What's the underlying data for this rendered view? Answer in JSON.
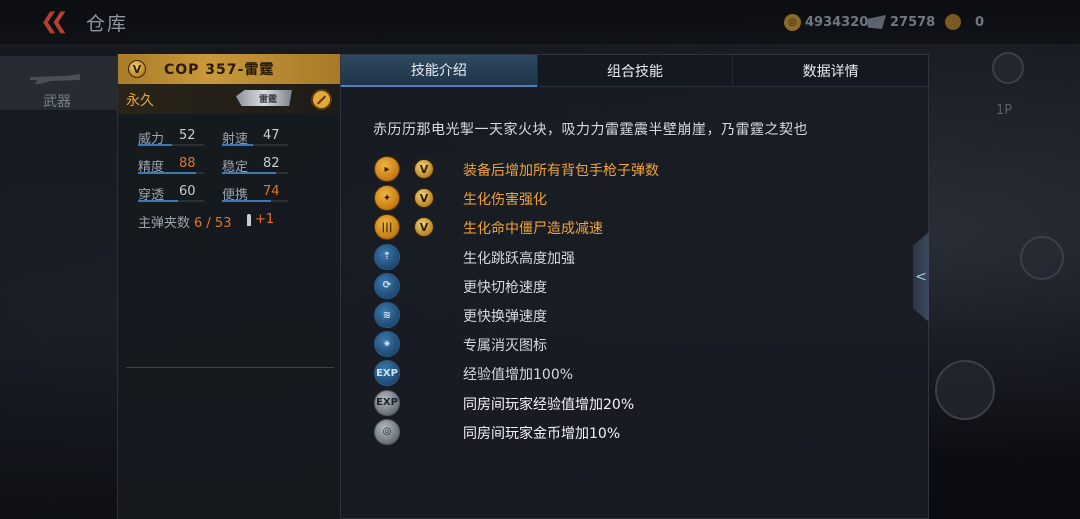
{
  "header": {
    "title": "仓库",
    "gold": "4934320",
    "tickets": "27578",
    "medals": "0"
  },
  "side_nav": {
    "weapons_label": "武器"
  },
  "right_controls": {
    "view_label": "1P"
  },
  "weapon": {
    "rank_badge": "V",
    "name": "COP 357-雷霆",
    "duration": "永久",
    "thumb_label": "雷霆",
    "stats": [
      {
        "label": "威力",
        "value": "52",
        "fill": 0.52,
        "highlight": false
      },
      {
        "label": "射速",
        "value": "47",
        "fill": 0.47,
        "highlight": false
      },
      {
        "label": "精度",
        "value": "88",
        "fill": 0.88,
        "highlight": true
      },
      {
        "label": "稳定",
        "value": "82",
        "fill": 0.82,
        "highlight": false
      },
      {
        "label": "穿透",
        "value": "60",
        "fill": 0.6,
        "highlight": false
      },
      {
        "label": "便携",
        "value": "74",
        "fill": 0.74,
        "highlight": true
      }
    ],
    "magazine_label": "主弹夹数",
    "magazine_value": "6 / 53",
    "magazine_bonus": "+1"
  },
  "tabs": [
    {
      "label": "技能介绍",
      "active": true
    },
    {
      "label": "组合技能",
      "active": false
    },
    {
      "label": "数据详情",
      "active": false
    }
  ],
  "description": "赤历历那电光掣一天家火块，吸力力雷霆震半壁崩崖，乃雷霆之契也",
  "skills": [
    {
      "icon": "pistol-ammo-icon",
      "glyph": "▸",
      "style": "gold",
      "rank": "V",
      "text": "装备后增加所有背包手枪子弹数",
      "text_style": "gold"
    },
    {
      "icon": "biohazard-damage-icon",
      "glyph": "✦",
      "style": "gold",
      "rank": "V",
      "text": "生化伤害强化",
      "text_style": "gold"
    },
    {
      "icon": "slow-zombie-icon",
      "glyph": "|||",
      "style": "gold",
      "rank": "V",
      "text": "生化命中僵尸造成减速",
      "text_style": "gold"
    },
    {
      "icon": "jump-boost-icon",
      "glyph": "⇡",
      "style": "blue",
      "rank": "",
      "text": "生化跳跃高度加强",
      "text_style": "white"
    },
    {
      "icon": "weapon-switch-icon",
      "glyph": "⟳",
      "style": "blue",
      "rank": "",
      "text": "更快切枪速度",
      "text_style": "white"
    },
    {
      "icon": "reload-icon",
      "glyph": "≋",
      "style": "blue",
      "rank": "",
      "text": "更快换弹速度",
      "text_style": "white"
    },
    {
      "icon": "elimination-mark-icon",
      "glyph": "✷",
      "style": "blue",
      "rank": "",
      "text": "专属消灭图标",
      "text_style": "white"
    },
    {
      "icon": "exp-boost-icon",
      "glyph": "EXP",
      "style": "blue",
      "rank": "",
      "text": "经验值增加100%",
      "text_style": "white"
    },
    {
      "icon": "room-exp-icon",
      "glyph": "EXP",
      "style": "gray",
      "rank": "",
      "text": "同房间玩家经验值增加20%",
      "text_style": "bright"
    },
    {
      "icon": "room-gold-icon",
      "glyph": "◎",
      "style": "gray",
      "rank": "",
      "text": "同房间玩家金币增加10%",
      "text_style": "bright"
    }
  ],
  "collapse_glyph": "<"
}
